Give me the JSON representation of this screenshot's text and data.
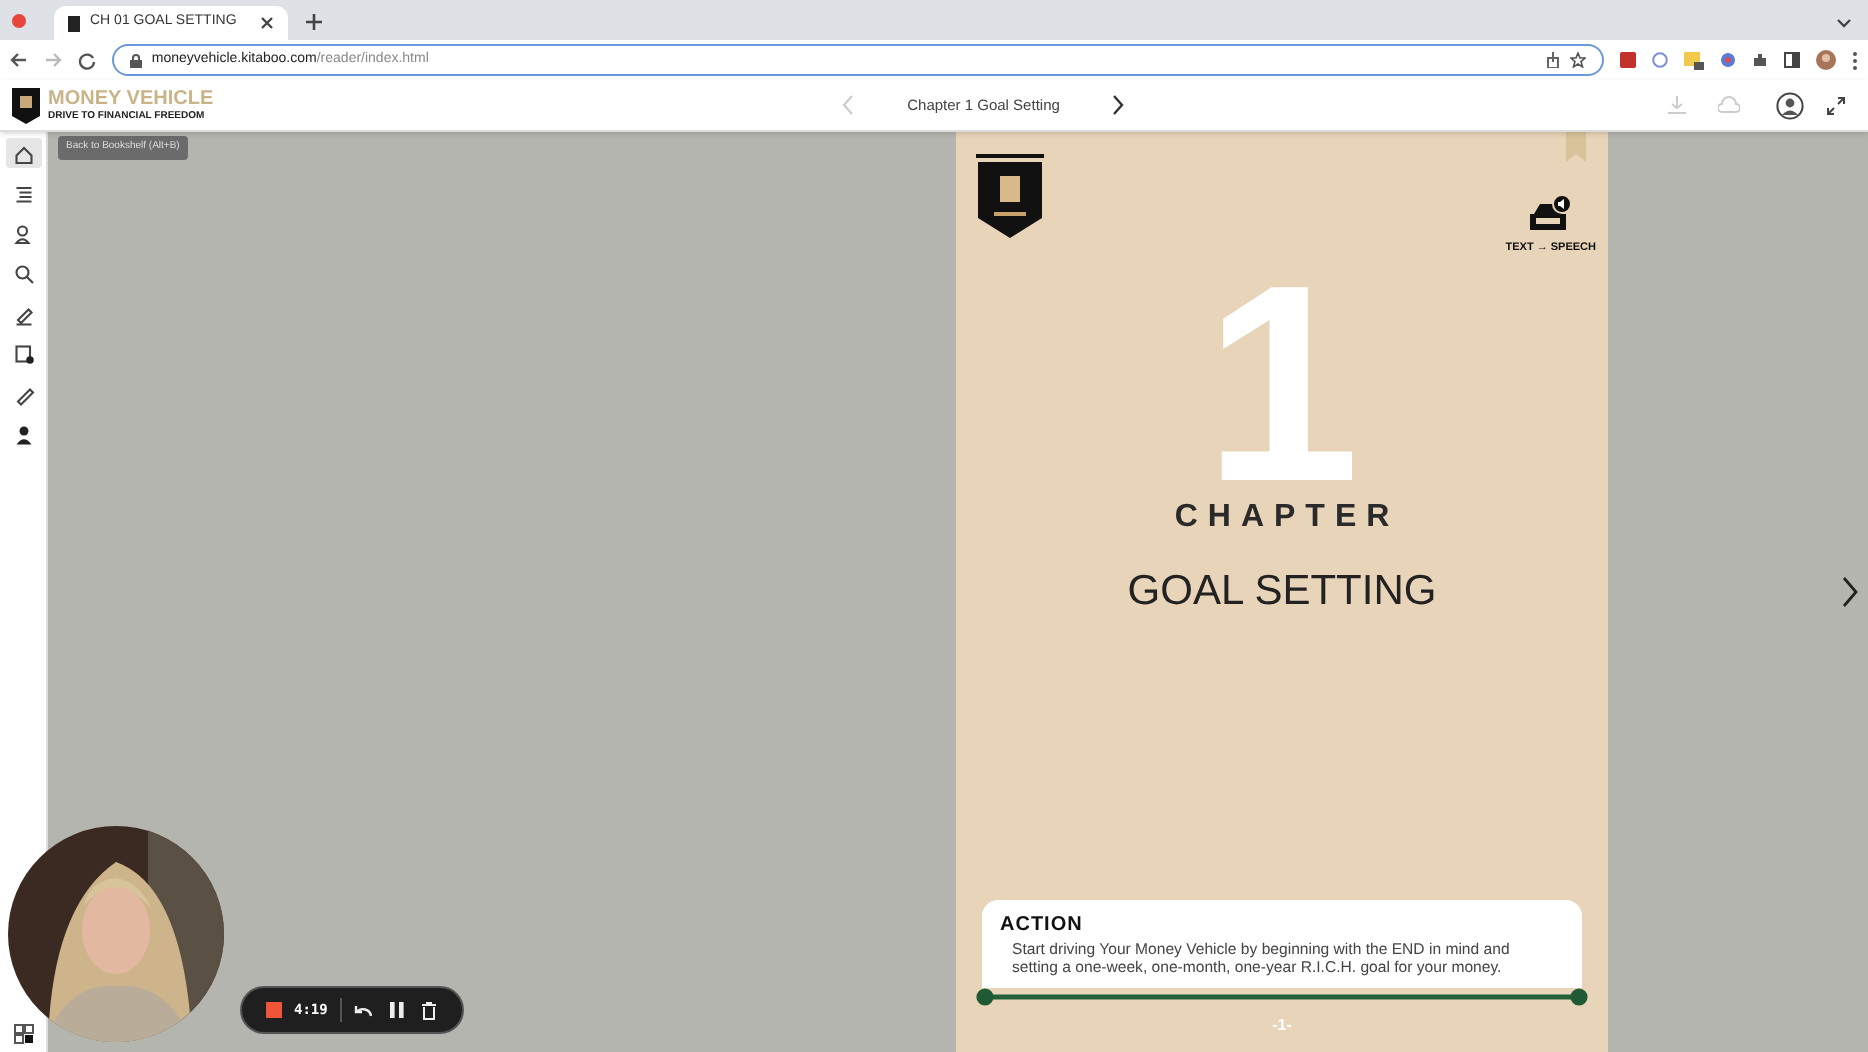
{
  "browser": {
    "tab_title": "CH 01 GOAL SETTING",
    "url_host": "moneyvehicle.kitaboo.com",
    "url_path": "/reader/index.html"
  },
  "header": {
    "logo_title": "MONEY VEHICLE",
    "logo_tagline": "DRIVE TO FINANCIAL FREEDOM",
    "chapter": "Chapter 1 Goal Setting",
    "prev_disabled": true
  },
  "sidebar": {
    "items": [
      {
        "selected": true
      },
      {
        "selected": false
      },
      {
        "selected": false
      },
      {
        "selected": false
      },
      {
        "selected": false
      },
      {
        "selected": false
      },
      {
        "selected": false
      },
      {
        "selected": false
      }
    ],
    "tooltip": "Back to Bookshelf (Alt+B)"
  },
  "page": {
    "tts_label": "TEXT → SPEECH",
    "chapter_number": "1",
    "chapter_word": "CHAPTER",
    "title": "GOAL SETTING",
    "action_heading": "ACTION",
    "action_text": "Start driving Your Money Vehicle by beginning with the END in mind and setting a one-week, one-month, one-year R.I.C.H. goal for your money.",
    "page_number": "-1-"
  },
  "recorder": {
    "time": "4:19"
  }
}
